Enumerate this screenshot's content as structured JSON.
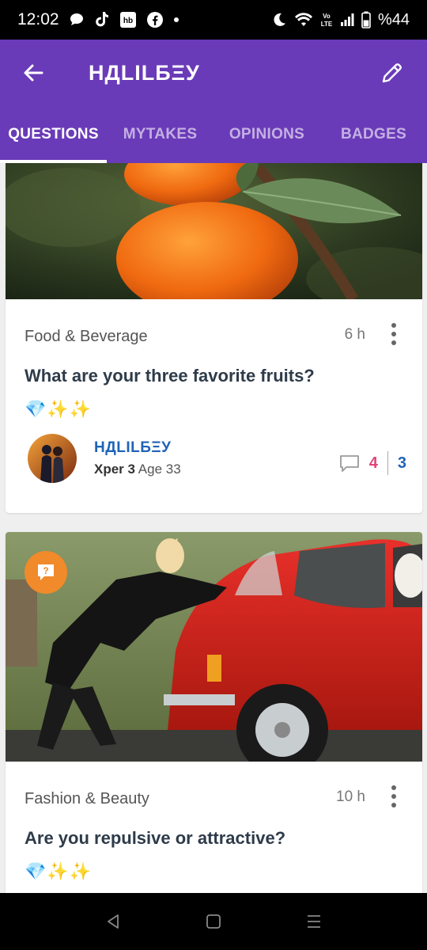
{
  "status_bar": {
    "time": "12:02",
    "battery": "%44"
  },
  "header": {
    "title": "НДLІLБΞУ"
  },
  "tabs": [
    {
      "label": "QUESTIONS",
      "active": true
    },
    {
      "label": "MYTAKES",
      "active": false
    },
    {
      "label": "OPINIONS",
      "active": false
    },
    {
      "label": "BADGES",
      "active": false
    }
  ],
  "posts": [
    {
      "category": "Food & Beverage",
      "time_ago": "6 h",
      "title": "What are your three favorite fruits?",
      "emojis": "💎✨✨",
      "author": {
        "name": "НДLІLБΞУ",
        "xper": "Xper 3",
        "age": "Age 33"
      },
      "comments": "4",
      "opinions": "3"
    },
    {
      "category": "Fashion & Beauty",
      "time_ago": "10 h",
      "title": "Are you repulsive or attractive?",
      "emojis": "💎✨✨",
      "badge": "?"
    }
  ],
  "colors": {
    "app_bar": "#6a3bb8",
    "author_name": "#1e63b8",
    "comments": "#e0457b",
    "badge": "#f08a2b"
  }
}
